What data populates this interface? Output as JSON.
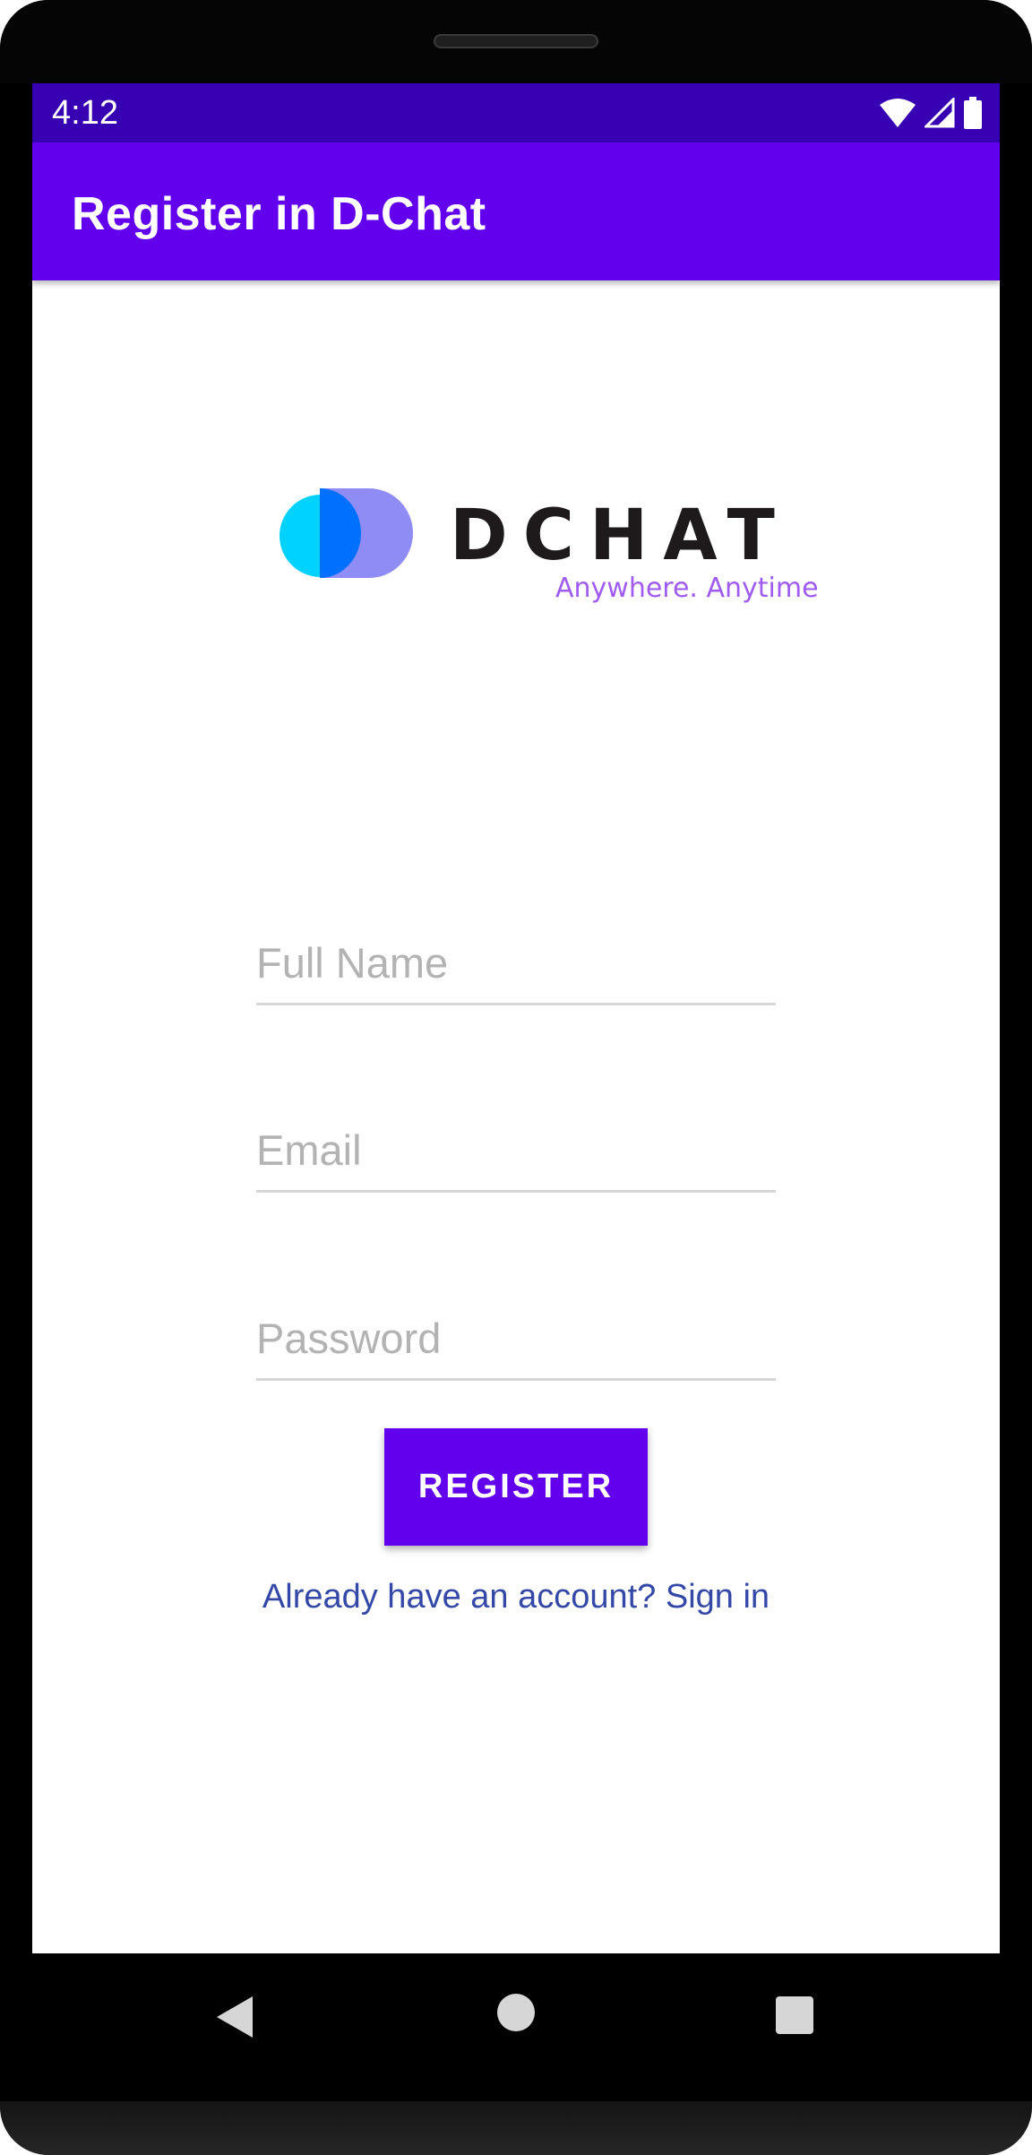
{
  "status_bar": {
    "time": "4:12",
    "icons": [
      "wifi-icon",
      "cell-signal-icon",
      "battery-icon"
    ]
  },
  "app_bar": {
    "title": "Register in D-Chat"
  },
  "logo": {
    "wordmark": "DCHAT",
    "tagline": "Anywhere. Anytime"
  },
  "form": {
    "full_name": {
      "value": "",
      "placeholder": "Full Name"
    },
    "email": {
      "value": "",
      "placeholder": "Email"
    },
    "password": {
      "value": "",
      "placeholder": "Password"
    },
    "register_label": "REGISTER",
    "signin_link": "Already have an account? Sign in"
  },
  "nav_bar": {
    "icons": [
      "back-icon",
      "home-icon",
      "recent-apps-icon"
    ]
  },
  "colors": {
    "status_bar": "#3700b3",
    "primary": "#6200ee",
    "link": "#3448a8",
    "tagline": "#a05cf0"
  }
}
